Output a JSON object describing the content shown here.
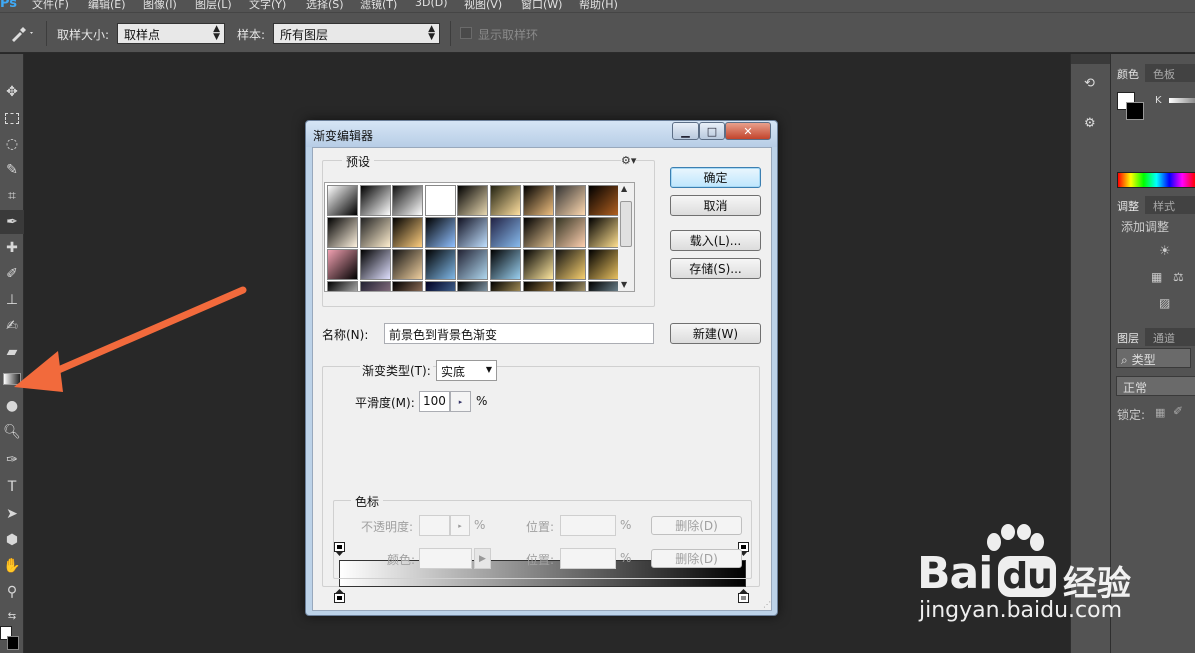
{
  "app": {
    "logo": "Ps",
    "menu": [
      "文件(F)",
      "编辑(E)",
      "图像(I)",
      "图层(L)",
      "文字(Y)",
      "选择(S)",
      "滤镜(T)",
      "3D(D)",
      "视图(V)",
      "窗口(W)",
      "帮助(H)"
    ]
  },
  "options_bar": {
    "sample_size_label": "取样大小:",
    "sample_size_value": "取样点",
    "sample_label": "样本:",
    "sample_value": "所有图层",
    "show_ring_label": "显示取样环"
  },
  "right_panels": {
    "color_tab": "颜色",
    "swatches_tab": "色板",
    "k_label": "K",
    "adjust_tab": "调整",
    "styles_tab": "样式",
    "add_adjustment": "添加调整",
    "layers_tab": "图层",
    "channels_tab": "通道",
    "kind_filter": "类型",
    "blend_mode": "正常",
    "lock_label": "锁定:"
  },
  "dialog": {
    "title": "渐变编辑器",
    "presets_label": "预设",
    "ok": "确定",
    "cancel": "取消",
    "load": "载入(L)...",
    "save": "存储(S)...",
    "name_label": "名称(N):",
    "name_value": "前景色到背景色渐变",
    "new_button": "新建(W)",
    "gradient_type_label": "渐变类型(T):",
    "gradient_type_value": "实底",
    "smoothness_label": "平滑度(M):",
    "smoothness_value": "100",
    "percent": "%",
    "stops_group": "色标",
    "opacity_label": "不透明度:",
    "location_label": "位置:",
    "delete_label": "删除(D)",
    "color_label": "颜色:"
  },
  "watermark": {
    "brand": "Bai",
    "brand2": "du",
    "cn": "经验",
    "url": "jingyan.baidu.com"
  },
  "colors": {
    "arrow": "#f26a3c",
    "panel_bg": "#535353",
    "canvas_bg": "#282828"
  }
}
